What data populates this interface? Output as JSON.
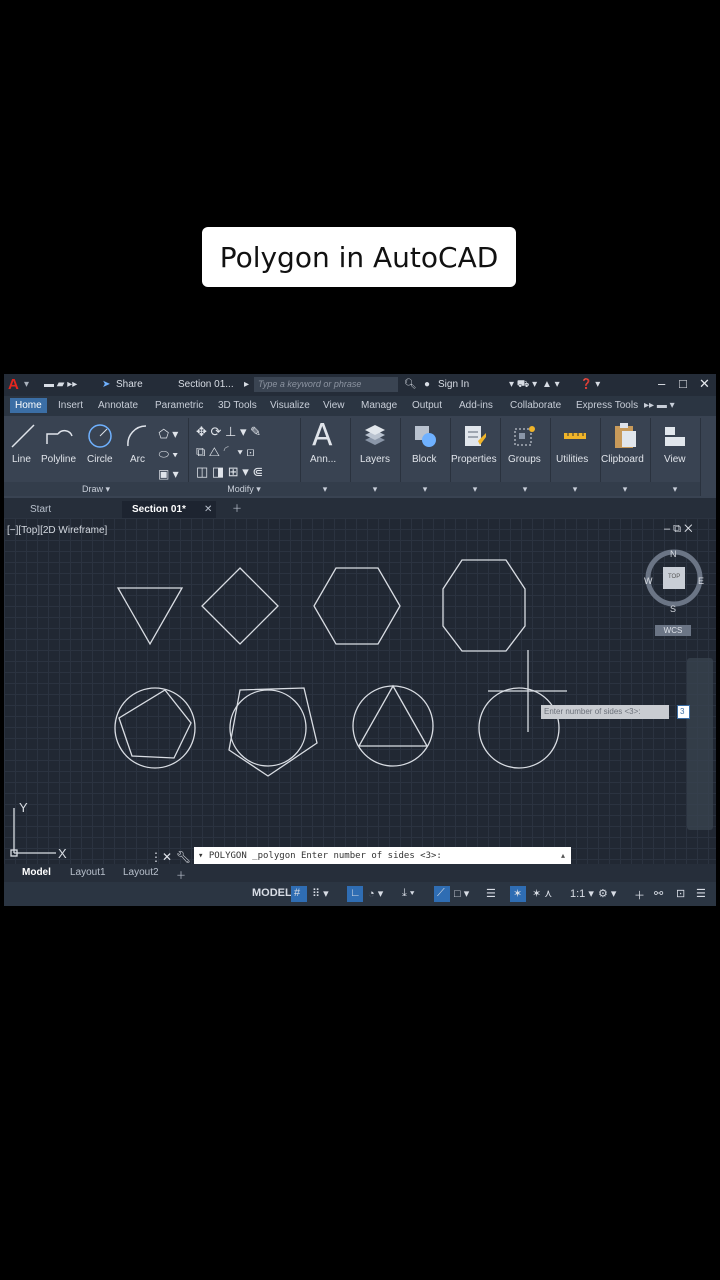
{
  "caption": "Polygon in AutoCAD",
  "titlebar": {
    "share": "Share",
    "doc_title": "Section 01...",
    "search_placeholder": "Type a keyword or phrase",
    "sign_in": "Sign In"
  },
  "ribbon_tabs": [
    "Home",
    "Insert",
    "Annotate",
    "Parametric",
    "3D Tools",
    "Visualize",
    "View",
    "Manage",
    "Output",
    "Add-ins",
    "Collaborate",
    "Express Tools"
  ],
  "draw_tools": [
    "Line",
    "Polyline",
    "Circle",
    "Arc"
  ],
  "panels": {
    "draw": "Draw",
    "modify": "Modify"
  },
  "big_tools": [
    "Ann...",
    "Layers",
    "Block",
    "Properties",
    "Groups",
    "Utilities",
    "Clipboard",
    "View"
  ],
  "doc_tabs": {
    "start": "Start",
    "active": "Section 01*"
  },
  "viewport": {
    "label": "[−][Top][2D Wireframe]",
    "compass": {
      "n": "N",
      "s": "S",
      "e": "E",
      "w": "W",
      "top": "TOP"
    },
    "wcs": "WCS",
    "axis_y": "Y",
    "axis_x": "X",
    "prompt_text": "Enter number of sides <3>:",
    "prompt_value": "3"
  },
  "command_line": "▾ POLYGON _polygon Enter number of sides <3>:",
  "layout_tabs": [
    "Model",
    "Layout1",
    "Layout2"
  ],
  "status": {
    "model": "MODEL",
    "scale": "1:1"
  },
  "colors": {
    "accent": "#3b6ea5",
    "logo": "#e3261e",
    "background": "#000000"
  }
}
